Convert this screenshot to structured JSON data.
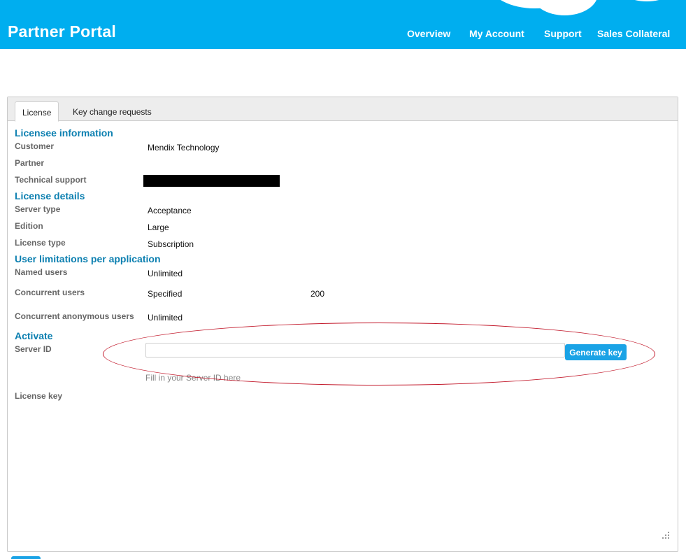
{
  "header": {
    "title": "Partner Portal",
    "nav": [
      "Overview",
      "My Account",
      "Support",
      "Sales Collateral"
    ]
  },
  "tabs": [
    "License",
    "Key change requests"
  ],
  "licensee": {
    "heading": "Licensee information",
    "customer_label": "Customer",
    "customer_value": "Mendix Technology",
    "partner_label": "Partner",
    "support_label": "Technical support"
  },
  "license_details": {
    "heading": "License details",
    "server_type_label": "Server type",
    "server_type_value": "Acceptance",
    "edition_label": "Edition",
    "edition_value": "Large",
    "license_type_label": "License type",
    "license_type_value": "Subscription"
  },
  "user_limits": {
    "heading": "User limitations per application",
    "named_label": "Named users",
    "named_value": "Unlimited",
    "concurrent_label": "Concurrent users",
    "concurrent_value": "Specified",
    "concurrent_count": "200",
    "anon_label": "Concurrent anonymous users",
    "anon_value": "Unlimited"
  },
  "activate": {
    "heading": "Activate",
    "server_id_label": "Server ID",
    "server_id_value": "",
    "generate_label": "Generate key",
    "hint": "Fill in your Server ID here",
    "license_key_label": "License key"
  },
  "colors": {
    "brand": "#00aeef",
    "heading": "#0b7fb0",
    "button": "#1aa3e6",
    "annotation": "#c2182a"
  }
}
